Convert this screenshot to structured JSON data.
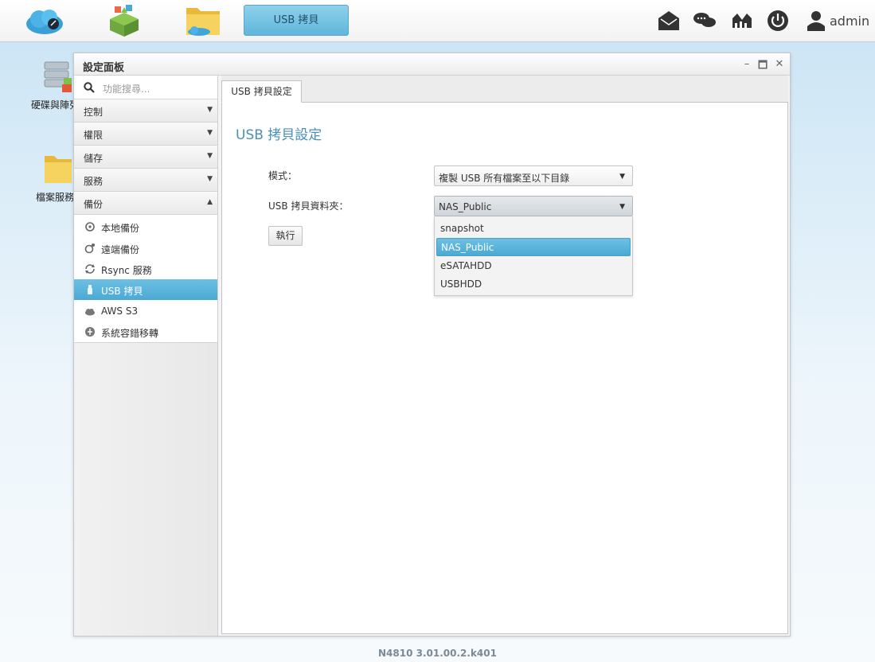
{
  "topbar": {
    "active_tab_label": "USB 拷貝",
    "user_name": "admin",
    "icons": [
      "cloud-icon",
      "app-store-icon",
      "file-manager-icon",
      "mail-icon",
      "chat-icon",
      "monitor-icon",
      "power-icon",
      "user-icon"
    ]
  },
  "desktop": {
    "icons": [
      {
        "label": "硬碟與陣列",
        "icon": "disk-array-icon"
      },
      {
        "label": "檔案服務",
        "icon": "file-service-icon"
      }
    ]
  },
  "window": {
    "title": "設定面板",
    "controls": {
      "minimize": "–",
      "maximize": "🗖",
      "close": "✕"
    }
  },
  "sidebar": {
    "search_placeholder": "功能搜尋...",
    "groups": [
      {
        "label": "控制",
        "arrow": "▼"
      },
      {
        "label": "權限",
        "arrow": "▼"
      },
      {
        "label": "儲存",
        "arrow": "▼"
      },
      {
        "label": "服務",
        "arrow": "▼"
      },
      {
        "label": "備份",
        "arrow": "▲"
      }
    ],
    "items": [
      {
        "label": "本地備份",
        "icon": "local-backup-icon"
      },
      {
        "label": "遠端備份",
        "icon": "remote-backup-icon"
      },
      {
        "label": "Rsync 服務",
        "icon": "sync-icon"
      },
      {
        "label": "USB 拷貝",
        "icon": "usb-icon",
        "active": true
      },
      {
        "label": "AWS S3",
        "icon": "cloud-icon"
      },
      {
        "label": "系統容錯移轉",
        "icon": "failover-icon"
      }
    ]
  },
  "content": {
    "tab_label": "USB 拷貝設定",
    "title": "USB 拷貝設定",
    "mode_label": "模式：",
    "mode_value": "複製 USB 所有檔案至以下目錄",
    "folder_label": "USB 拷貝資料夾：",
    "folder_value": "NAS_Public",
    "execute_label": "執行",
    "dropdown_arrow": "▼",
    "folder_options": [
      "snapshot",
      "NAS_Public",
      "eSATAHDD",
      "USBHDD"
    ],
    "folder_selected_index": 1
  },
  "footer": {
    "version": "N4810   3.01.00.2.k401"
  },
  "colors": {
    "accent": "#4aa9d3",
    "title": "#4a90b8"
  }
}
